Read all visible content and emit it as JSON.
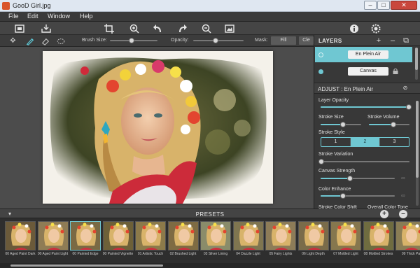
{
  "window": {
    "title": "GooD Girl.jpg",
    "minimize": "–",
    "maximize": "□",
    "close": "✕"
  },
  "menu": [
    "File",
    "Edit",
    "Window",
    "Help"
  ],
  "options": {
    "brush_size_label": "Brush Size:",
    "opacity_label": "Opacity:",
    "mask_label": "Mask:",
    "fill_label": "Fill",
    "clear_label": "Cle",
    "brush_size_value": 0.45,
    "opacity_value": 0.45
  },
  "layers": {
    "title": "LAYERS",
    "add": "+",
    "remove": "–",
    "items": [
      {
        "name": "En Plein Air",
        "selected": true
      },
      {
        "name": "Canvas",
        "locked": true
      }
    ]
  },
  "adjust": {
    "title": "ADJUST : En Plein Air",
    "layer_opacity_label": "Layer Opacity",
    "layer_opacity": 1.0,
    "stroke_size_label": "Stroke Size",
    "stroke_size": 0.55,
    "stroke_volume_label": "Stroke Volume",
    "stroke_volume": 0.6,
    "stroke_style_label": "Stroke Style",
    "stroke_style_options": [
      "1",
      "2",
      "3"
    ],
    "stroke_style_selected": "2",
    "stroke_variation_label": "Stroke Variation",
    "stroke_variation": 0.0,
    "canvas_strength_label": "Canvas Strength",
    "canvas_strength": 0.4,
    "color_enhance_label": "Color Enhance",
    "color_enhance": 0.3,
    "stroke_color_shift_label": "Stroke Color Shift",
    "overall_color_tone_label": "Overall Color Tone"
  },
  "presets": {
    "title": "PRESETS",
    "add": "+",
    "remove": "–",
    "items": [
      {
        "label": "00 Aged Paint Dark"
      },
      {
        "label": "00 Aged Paint Light"
      },
      {
        "label": "00 Painted Edge",
        "selected": true
      },
      {
        "label": "00 Painted Vignette"
      },
      {
        "label": "01 Artistic Touch"
      },
      {
        "label": "02 Brushed Light"
      },
      {
        "label": "03 Silver Lining"
      },
      {
        "label": "04 Dazzle Light"
      },
      {
        "label": "05 Fairy Lights"
      },
      {
        "label": "06 Light Depth"
      },
      {
        "label": "07 Mottled Light"
      },
      {
        "label": "08 Mottled Strokes"
      },
      {
        "label": "09 Thick Pa"
      }
    ]
  },
  "colors": {
    "accent": "#6fc7d2",
    "titlebar": "#dfe7f1",
    "panel": "#383838",
    "canvas_bg": "#4c4c4c"
  },
  "icons": {
    "toolbar": [
      "open-icon",
      "save-icon",
      "crop-icon",
      "zoom-in-icon",
      "undo-icon",
      "redo-icon",
      "zoom-out-icon",
      "fit-image-icon",
      "info-icon",
      "settings-icon"
    ],
    "tools": [
      "move-icon",
      "brush-icon",
      "eraser-icon",
      "lasso-icon"
    ]
  }
}
